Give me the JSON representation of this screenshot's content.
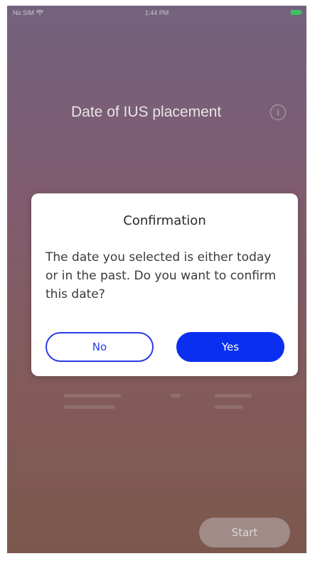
{
  "status_bar": {
    "carrier": "No SIM",
    "time": "1:44 PM",
    "wifi_icon": "wifi-icon",
    "battery_icon": "battery-icon",
    "battery_color": "#3dd66a"
  },
  "header": {
    "title": "Date of IUS placement",
    "info_icon": "info-icon",
    "info_glyph": "i"
  },
  "dialog": {
    "title": "Confirmation",
    "message": "The date you selected is either today or in the past. Do you want to confirm this date?",
    "no_label": "No",
    "yes_label": "Yes"
  },
  "footer": {
    "start_label": "Start"
  },
  "colors": {
    "accent": "#0a2ff0",
    "no_border": "#2a3be8"
  }
}
